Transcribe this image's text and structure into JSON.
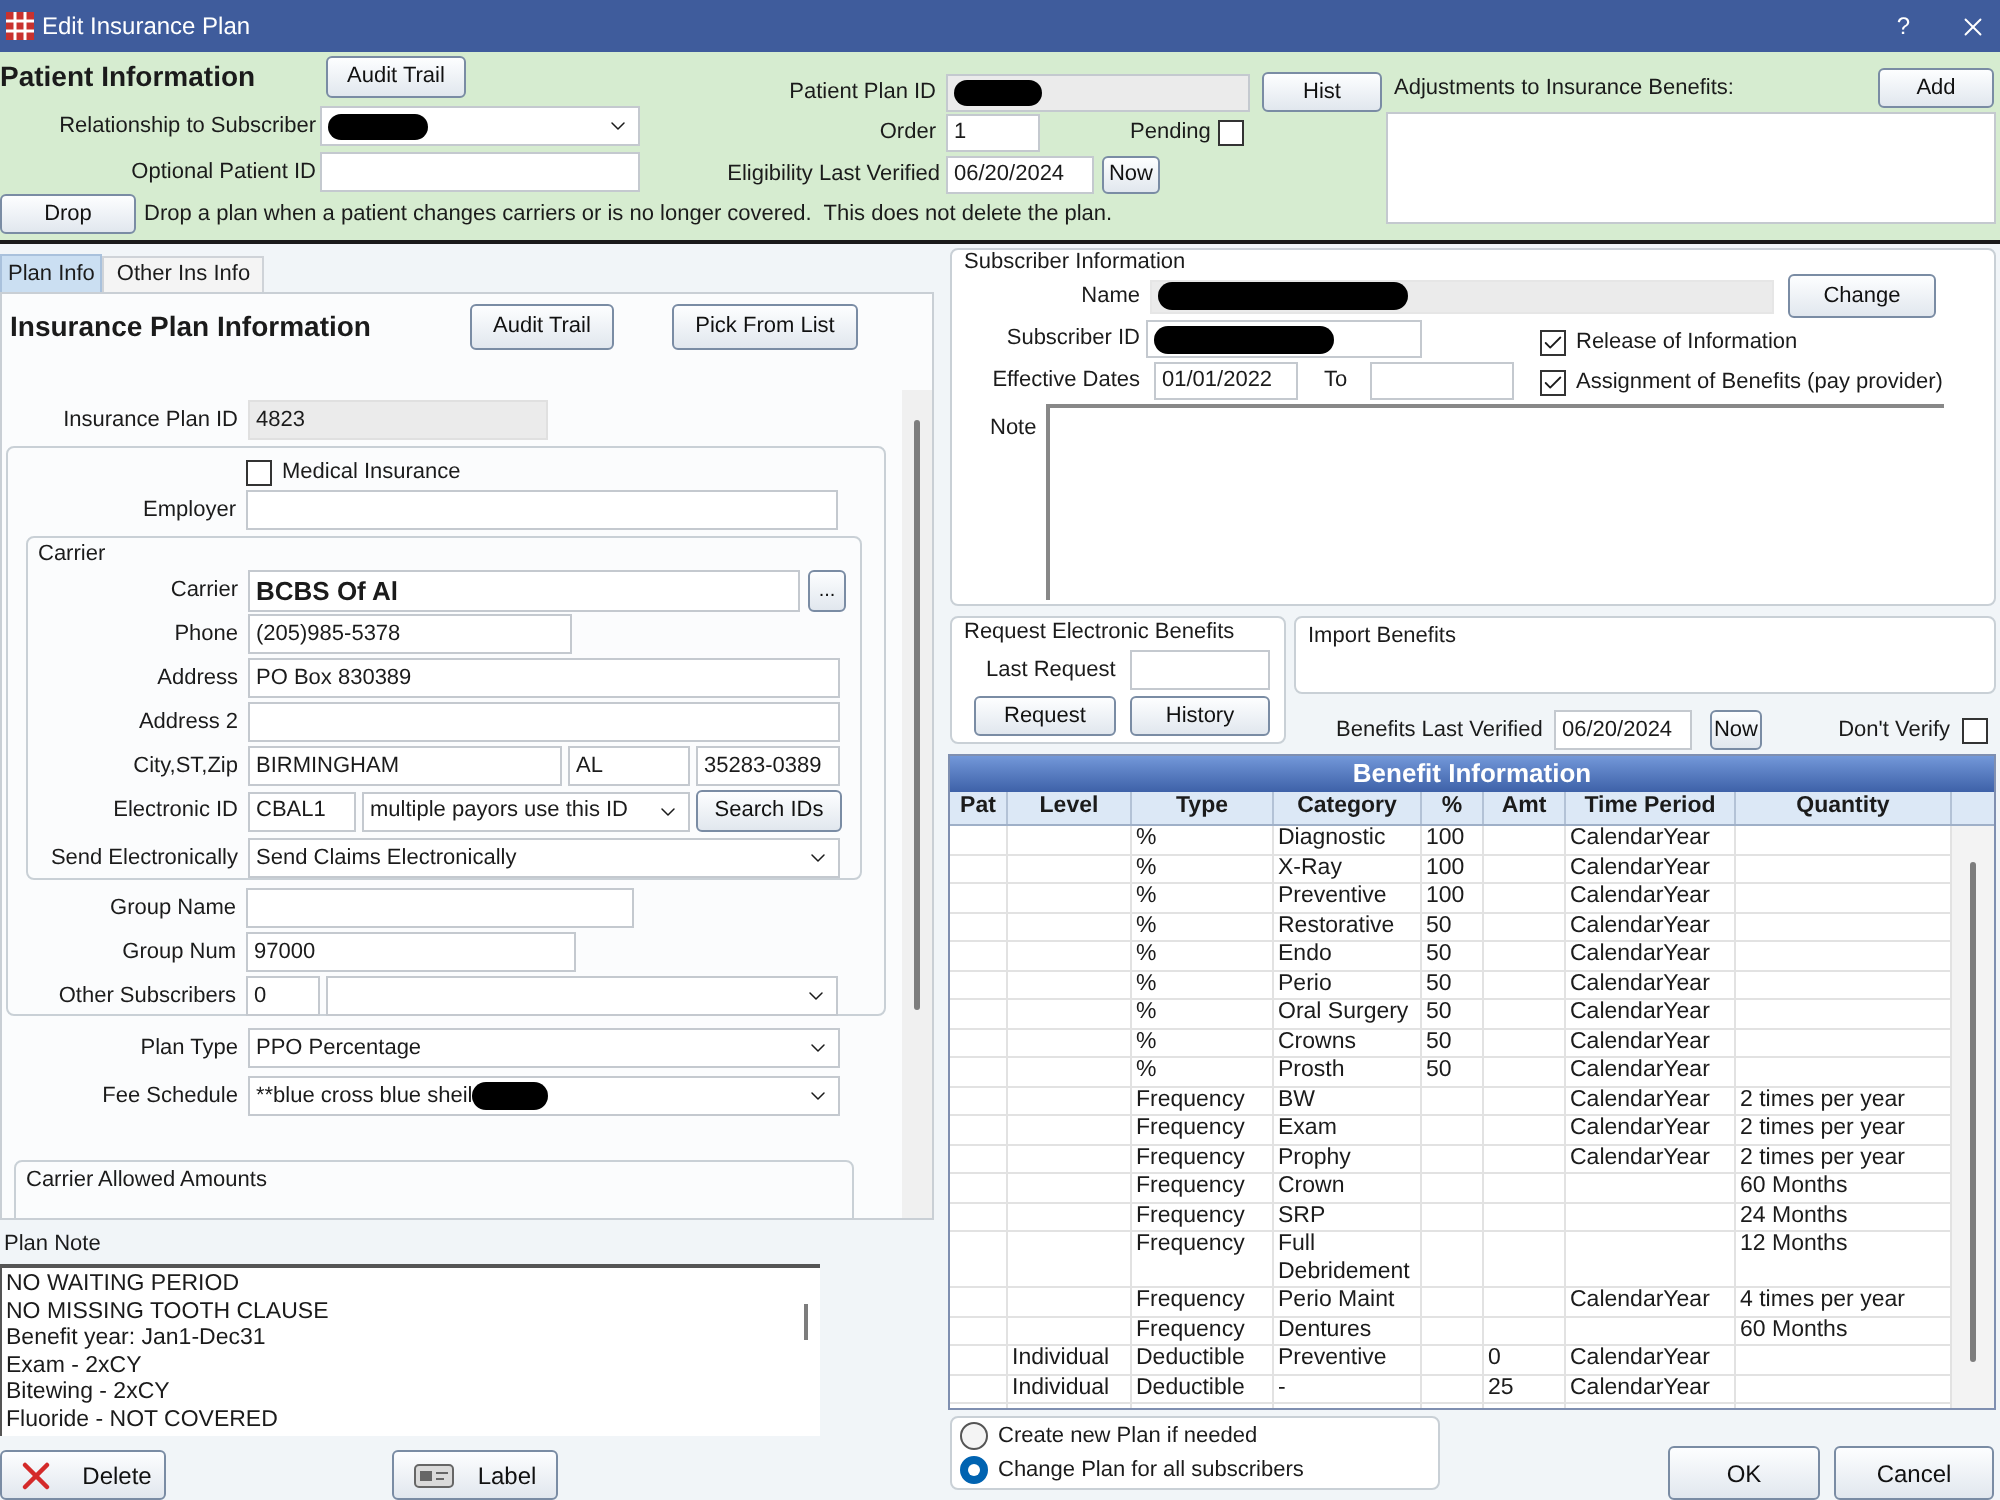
{
  "window": {
    "title": "Edit Insurance Plan",
    "help": "?"
  },
  "patient_info": {
    "heading": "Patient Information",
    "audit_button": "Audit Trail",
    "relationship": {
      "label": "Relationship to Subscriber",
      "redacted": true
    },
    "optional_id": {
      "label": "Optional Patient ID"
    },
    "drop_button": "Drop",
    "drop_note": "Drop a plan when a patient changes carriers or is no longer covered.  This does not delete the plan.",
    "plan_id": {
      "label": "Patient Plan ID",
      "redacted": true
    },
    "hist_button": "Hist",
    "order": {
      "label": "Order",
      "value": "1"
    },
    "pending": {
      "label": "Pending",
      "checked": false
    },
    "eligibility": {
      "label": "Eligibility Last Verified",
      "value": "06/20/2024",
      "button": "Now"
    },
    "adjustments": {
      "label": "Adjustments to Insurance Benefits:",
      "button": "Add"
    }
  },
  "tabs": [
    {
      "label": "Plan Info",
      "selected": true
    },
    {
      "label": "Other Ins Info",
      "selected": false
    }
  ],
  "plan_info": {
    "heading": "Insurance Plan Information",
    "buttons": [
      "Audit Trail",
      "Pick From List"
    ],
    "plan_id": {
      "label": "Insurance Plan ID",
      "value": "4823"
    },
    "medical_insurance": {
      "label": "Medical Insurance",
      "checked": false
    },
    "employer": {
      "label": "Employer"
    },
    "carrier": {
      "title": "Carrier",
      "carrier": {
        "label": "Carrier",
        "value": "BCBS Of Al",
        "button": "..."
      },
      "phone": {
        "label": "Phone",
        "value": "(205)985-5378"
      },
      "address": {
        "label": "Address",
        "value": "PO Box 830389"
      },
      "address_2": {
        "label": "Address 2"
      },
      "city_st_zip": {
        "label": "City,ST,Zip",
        "city": "BIRMINGHAM",
        "state": "AL",
        "zip": "35283-0389"
      },
      "electronic_id": {
        "label": "Electronic ID",
        "value": "CBAL1",
        "payor_option": "multiple payors use this ID",
        "button": "Search IDs"
      },
      "send_electronically": {
        "label": "Send Electronically",
        "value": "Send Claims Electronically"
      }
    },
    "group_name": {
      "label": "Group Name"
    },
    "group_num": {
      "label": "Group Num",
      "value": "97000"
    },
    "other_subscribers": {
      "label": "Other Subscribers",
      "value": "0"
    },
    "plan_type": {
      "label": "Plan Type",
      "value": "PPO Percentage"
    },
    "fee_schedule": {
      "label": "Fee Schedule",
      "value": "**blue cross blue sheil",
      "redacted": true
    },
    "allowed_amounts": {
      "title": "Carrier Allowed Amounts"
    }
  },
  "plan_note": {
    "label": "Plan Note",
    "lines": [
      "NO WAITING PERIOD",
      "NO MISSING TOOTH CLAUSE",
      "Benefit year: Jan1-Dec31",
      "Exam - 2xCY",
      "Bitewing - 2xCY",
      "Fluoride - NOT COVERED"
    ]
  },
  "left_buttons": [
    {
      "kind": "delete",
      "label": "Delete"
    },
    {
      "kind": "label",
      "label": "Label"
    }
  ],
  "subscriber": {
    "title": "Subscriber Information",
    "name": {
      "label": "Name",
      "redacted": true
    },
    "change_button": "Change",
    "subscriber_id": {
      "label": "Subscriber ID",
      "redacted": true
    },
    "release": {
      "label": "Release of Information",
      "checked": true
    },
    "effective_dates": {
      "label": "Effective Dates",
      "from": "01/01/2022",
      "to_label": "To"
    },
    "assignment": {
      "label": "Assignment of Benefits (pay provider)",
      "checked": true
    },
    "note": {
      "label": "Note"
    }
  },
  "request_benefits": {
    "title": "Request Electronic Benefits",
    "last_request": {
      "label": "Last Request"
    },
    "buttons": [
      "Request",
      "History"
    ]
  },
  "import_benefits": {
    "title": "Import Benefits"
  },
  "benefits_verified": {
    "label": "Benefits Last Verified",
    "value": "06/20/2024",
    "button": "Now",
    "dont_verify": {
      "label": "Don't Verify",
      "checked": false
    }
  },
  "benefit_table": {
    "title": "Benefit Information",
    "columns": [
      "Pat",
      "Level",
      "Type",
      "Category",
      "%",
      "Amt",
      "Time Period",
      "Quantity"
    ],
    "rows": [
      {
        "type": "%",
        "category": "Diagnostic",
        "percent": "100",
        "time_period": "CalendarYear"
      },
      {
        "type": "%",
        "category": "X-Ray",
        "percent": "100",
        "time_period": "CalendarYear"
      },
      {
        "type": "%",
        "category": "Preventive",
        "percent": "100",
        "time_period": "CalendarYear"
      },
      {
        "type": "%",
        "category": "Restorative",
        "percent": "50",
        "time_period": "CalendarYear"
      },
      {
        "type": "%",
        "category": "Endo",
        "percent": "50",
        "time_period": "CalendarYear"
      },
      {
        "type": "%",
        "category": "Perio",
        "percent": "50",
        "time_period": "CalendarYear"
      },
      {
        "type": "%",
        "category": "Oral Surgery",
        "percent": "50",
        "time_period": "CalendarYear"
      },
      {
        "type": "%",
        "category": "Crowns",
        "percent": "50",
        "time_period": "CalendarYear"
      },
      {
        "type": "%",
        "category": "Prosth",
        "percent": "50",
        "time_period": "CalendarYear"
      },
      {
        "type": "Frequency",
        "category": "BW",
        "time_period": "CalendarYear",
        "quantity": "2 times per year"
      },
      {
        "type": "Frequency",
        "category": "Exam",
        "time_period": "CalendarYear",
        "quantity": "2 times per year"
      },
      {
        "type": "Frequency",
        "category": "Prophy",
        "time_period": "CalendarYear",
        "quantity": "2 times per year"
      },
      {
        "type": "Frequency",
        "category": "Crown",
        "quantity": "60 Months"
      },
      {
        "type": "Frequency",
        "category": "SRP",
        "quantity": "24 Months"
      },
      {
        "type": "Frequency",
        "category": "Full Debridement",
        "quantity": "12 Months"
      },
      {
        "type": "Frequency",
        "category": "Perio Maint",
        "time_period": "CalendarYear",
        "quantity": "4 times per year"
      },
      {
        "type": "Frequency",
        "category": "Dentures",
        "quantity": "60 Months"
      },
      {
        "level": "Individual",
        "type": "Deductible",
        "category": "Preventive",
        "amt": "0",
        "time_period": "CalendarYear"
      },
      {
        "level": "Individual",
        "type": "Deductible",
        "category": "-",
        "amt": "25",
        "time_period": "CalendarYear"
      }
    ]
  },
  "radio_options": [
    {
      "label": "Create new Plan if needed",
      "selected": false
    },
    {
      "label": "Change Plan for all subscribers",
      "selected": true
    }
  ],
  "dialog_buttons": [
    "OK",
    "Cancel"
  ]
}
